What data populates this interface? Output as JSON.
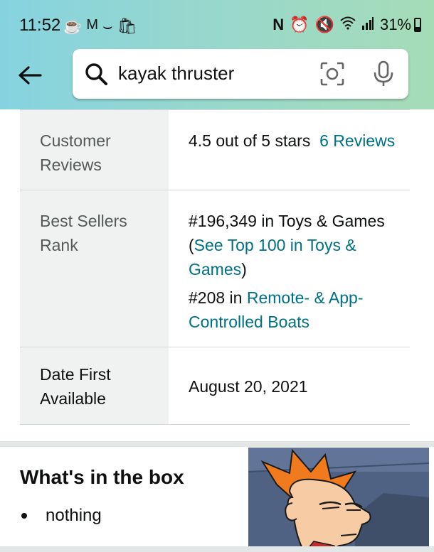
{
  "status_bar": {
    "time": "11:52",
    "battery": "31%"
  },
  "search": {
    "query": "kayak thruster"
  },
  "details": {
    "customer_reviews": {
      "label": "Customer Reviews",
      "rating_text": "4.5 out of 5 stars",
      "reviews_link": "6 Reviews"
    },
    "best_sellers_rank": {
      "label": "Best Sellers Rank",
      "rank1_text": "#196,349 in Toys & Games (",
      "rank1_link": "See Top 100 in Toys & Games",
      "rank1_close": ")",
      "rank2_text": "#208 in ",
      "rank2_link": "Remote- & App-Controlled Boats"
    },
    "date_first_available": {
      "label": "Date First Available",
      "value": "August 20, 2021"
    }
  },
  "whats_in_box": {
    "title": "What's in the box",
    "items": [
      "nothing"
    ]
  },
  "colors": {
    "link": "#007185",
    "header_gradient_start": "#86d3e0",
    "header_gradient_end": "#a5dcb8"
  }
}
